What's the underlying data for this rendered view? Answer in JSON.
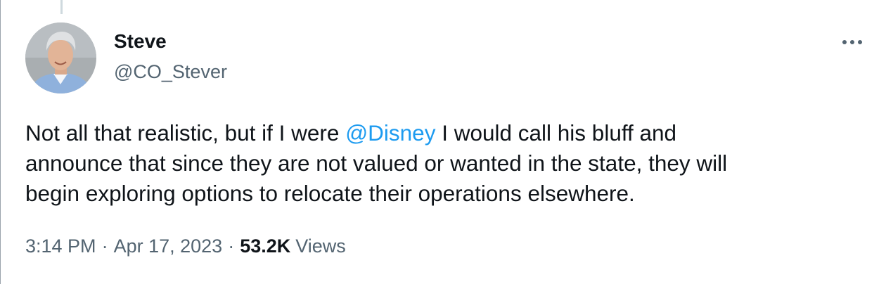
{
  "tweet": {
    "author": {
      "display_name": "Steve",
      "handle": "@CO_Stever"
    },
    "text": {
      "line1_before": "Not all that realistic, but if I were ",
      "mention": "@Disney",
      "line1_after": " I would call his bluff and",
      "line2": "announce that since they are not valued or wanted in the state, they will",
      "line3": "begin exploring options to relocate their operations elsewhere."
    },
    "meta": {
      "time": "3:14 PM",
      "separator": "·",
      "date": "Apr 17, 2023",
      "views_count": "53.2K",
      "views_label": "Views"
    }
  },
  "colors": {
    "mention": "#1d9bf0",
    "secondary_text": "#536471",
    "primary_text": "#0f1419",
    "thread_line": "#cfd9de"
  },
  "icons": {
    "more": "more-horizontal-icon"
  }
}
